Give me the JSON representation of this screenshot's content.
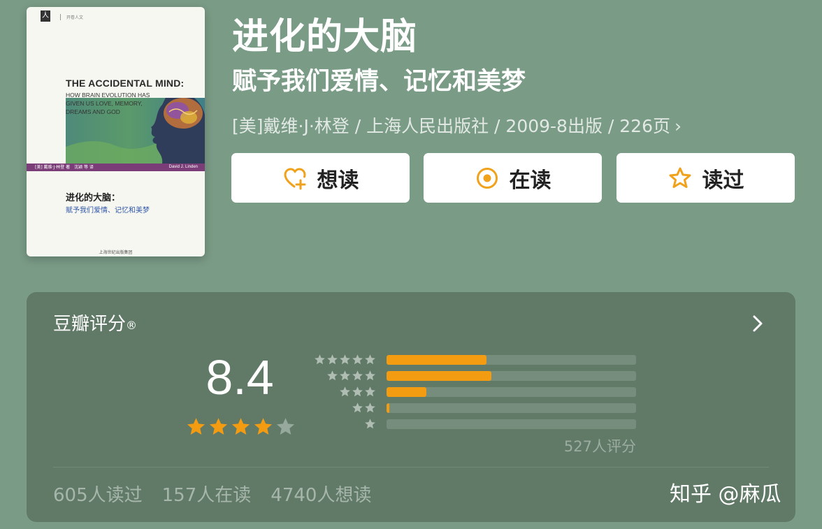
{
  "book": {
    "title": "进化的大脑",
    "subtitle": "赋予我们爱情、记忆和美梦",
    "meta": "[美]戴维·J·林登 / 上海人民出版社 / 2009-8出版 / 226页",
    "meta_chevron": "›"
  },
  "cover": {
    "publisher_mark": "人",
    "series": "开卷人文",
    "en_title": "THE ACCIDENTAL MIND:",
    "en_subtitle": "HOW BRAIN EVOLUTION HAS GIVEN US LOVE, MEMORY, DREAMS AND GOD",
    "translator_line": "[美] 戴维·J·林登 著　沈颖 等 译",
    "author_en": "David J. Linden",
    "cn_title": "进化的大脑：",
    "cn_subtitle": "赋予我们爱情、记忆和美梦",
    "publisher_bottom": "上海世纪出版集团"
  },
  "actions": {
    "want_label": "想读",
    "reading_label": "在读",
    "read_label": "读过",
    "icons": [
      "heart-plus-icon",
      "target-icon",
      "star-outline-icon"
    ]
  },
  "rating": {
    "header": "豆瓣评分",
    "header_mark": "®",
    "score": "8.4",
    "star_rating": 4,
    "star_max": 5,
    "distribution": [
      {
        "stars": 5,
        "fraction": 0.4
      },
      {
        "stars": 4,
        "fraction": 0.42
      },
      {
        "stars": 3,
        "fraction": 0.16
      },
      {
        "stars": 2,
        "fraction": 0.01
      },
      {
        "stars": 1,
        "fraction": 0.0
      }
    ],
    "count_text": "527人评分"
  },
  "stats": {
    "read": "605人读过",
    "reading": "157人在读",
    "want": "4740人想读"
  },
  "watermark": "知乎 @麻瓜",
  "colors": {
    "background": "#7a9b86",
    "card": "#607a67",
    "accent": "#f39c12"
  }
}
